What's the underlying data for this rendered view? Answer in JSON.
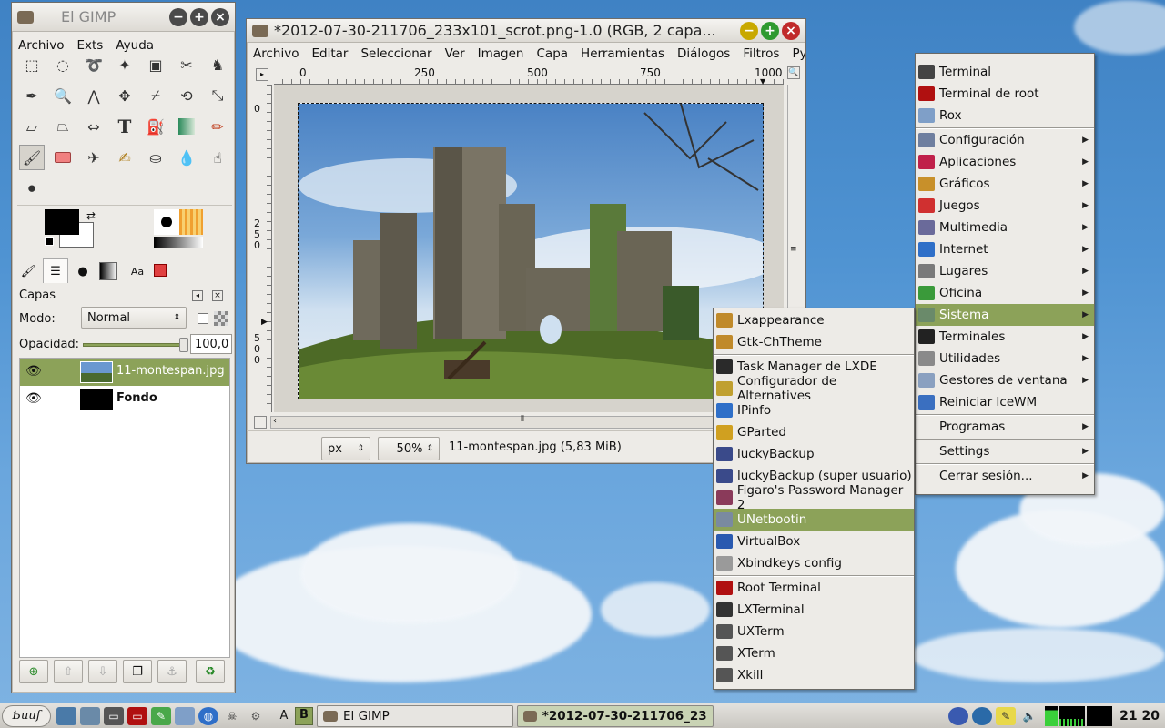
{
  "gimp_toolbox": {
    "title": "El GIMP",
    "menu": [
      "Archivo",
      "Exts",
      "Ayuda"
    ],
    "layers": {
      "panel_title": "Capas",
      "mode_label": "Modo:",
      "mode_value": "Normal",
      "opacity_label": "Opacidad:",
      "opacity_value": "100,0",
      "items": [
        {
          "name": "11-montespan.jpg"
        },
        {
          "name": "Fondo"
        }
      ]
    }
  },
  "image_window": {
    "title": "*2012-07-30-211706_233x101_scrot.png-1.0 (RGB, 2 capa...",
    "menu": [
      "Archivo",
      "Editar",
      "Seleccionar",
      "Ver",
      "Imagen",
      "Capa",
      "Herramientas",
      "Diálogos",
      "Filtros",
      "Pytho"
    ],
    "ruler_h": [
      "0",
      "250",
      "500",
      "750",
      "1000"
    ],
    "ruler_v": [
      "0",
      "2",
      "5",
      "0",
      "5",
      "0",
      "0"
    ],
    "unit": "px",
    "zoom": "50%",
    "status": "11-montespan.jpg (5,83 MiB)"
  },
  "main_menu": {
    "items": [
      {
        "label": "Terminal",
        "icon": "terminal-icon",
        "color": "#444"
      },
      {
        "label": "Terminal de root",
        "icon": "root-terminal-icon",
        "color": "#b01010"
      },
      {
        "label": "Rox",
        "icon": "folder-icon",
        "color": "#7f9fc8"
      },
      {
        "label": "Configuración",
        "icon": "tools-icon",
        "color": "#6f7f9f",
        "submenu": true
      },
      {
        "label": "Aplicaciones",
        "icon": "debian-icon",
        "color": "#c0204a",
        "submenu": true
      },
      {
        "label": "Gráficos",
        "icon": "palette-icon",
        "color": "#c8902a",
        "submenu": true
      },
      {
        "label": "Juegos",
        "icon": "cards-icon",
        "color": "#d03030",
        "submenu": true
      },
      {
        "label": "Multimedia",
        "icon": "multimedia-icon",
        "color": "#6a6a9a",
        "submenu": true
      },
      {
        "label": "Internet",
        "icon": "globe-icon",
        "color": "#2f6fc8",
        "submenu": true
      },
      {
        "label": "Lugares",
        "icon": "places-icon",
        "color": "#7a7a7a",
        "submenu": true
      },
      {
        "label": "Oficina",
        "icon": "office-icon",
        "color": "#3a9a3a",
        "submenu": true
      },
      {
        "label": "Sistema",
        "icon": "system-icon",
        "color": "#6a8a6a",
        "submenu": true,
        "highlighted": true
      },
      {
        "label": "Terminales",
        "icon": "terminals-icon",
        "color": "#222",
        "submenu": true
      },
      {
        "label": "Utilidades",
        "icon": "utilities-icon",
        "color": "#8a8a8a",
        "submenu": true
      },
      {
        "label": "Gestores de ventana",
        "icon": "windows-icon",
        "color": "#8aa0c0",
        "submenu": true
      },
      {
        "label": "Reiniciar IceWM",
        "icon": "restart-icon",
        "color": "#3a6fc0"
      },
      {
        "label": "Programas",
        "submenu": true
      },
      {
        "label": "Settings",
        "submenu": true
      },
      {
        "label": "Cerrar sesión...",
        "submenu": true
      }
    ]
  },
  "sistema_submenu": {
    "items": [
      {
        "label": "Lxappearance",
        "icon": "appearance-icon",
        "color": "#c08a2a"
      },
      {
        "label": "Gtk-ChTheme",
        "icon": "theme-icon",
        "color": "#c08a2a"
      },
      {
        "label": "Task Manager de LXDE",
        "icon": "task-manager-icon",
        "color": "#2a2a2a"
      },
      {
        "label": "Configurador de Alternatives",
        "icon": "config-icon",
        "color": "#c0a030"
      },
      {
        "label": "IPinfo",
        "icon": "info-icon",
        "color": "#2f6fc8"
      },
      {
        "label": "GParted",
        "icon": "gparted-icon",
        "color": "#d0a020"
      },
      {
        "label": "luckyBackup",
        "icon": "backup-icon",
        "color": "#3a4a8a"
      },
      {
        "label": "luckyBackup (super usuario)",
        "icon": "backup-root-icon",
        "color": "#3a4a8a"
      },
      {
        "label": "Figaro's Password Manager 2",
        "icon": "password-icon",
        "color": "#8a3a5a"
      },
      {
        "label": "UNetbootin",
        "icon": "unetbootin-icon",
        "color": "#7a8aa0",
        "highlighted": true
      },
      {
        "label": "VirtualBox",
        "icon": "virtualbox-icon",
        "color": "#2a5ab0"
      },
      {
        "label": "Xbindkeys config",
        "icon": "keys-icon",
        "color": "#9a9a9a"
      },
      {
        "label": "Root Terminal",
        "icon": "root-terminal-icon",
        "color": "#b01010"
      },
      {
        "label": "LXTerminal",
        "icon": "lxterminal-icon",
        "color": "#333"
      },
      {
        "label": "UXTerm",
        "icon": "uxterm-icon",
        "color": "#555"
      },
      {
        "label": "XTerm",
        "icon": "xterm-icon",
        "color": "#555"
      },
      {
        "label": "Xkill",
        "icon": "skull-icon",
        "color": "#555"
      }
    ]
  },
  "taskbar": {
    "start_label": "Ƅuuf",
    "workspace_a": "A",
    "workspace_b": "B",
    "tasks": [
      {
        "label": "El GIMP"
      },
      {
        "label": "*2012-07-30-211706_23..."
      }
    ],
    "clock": "21 20"
  }
}
